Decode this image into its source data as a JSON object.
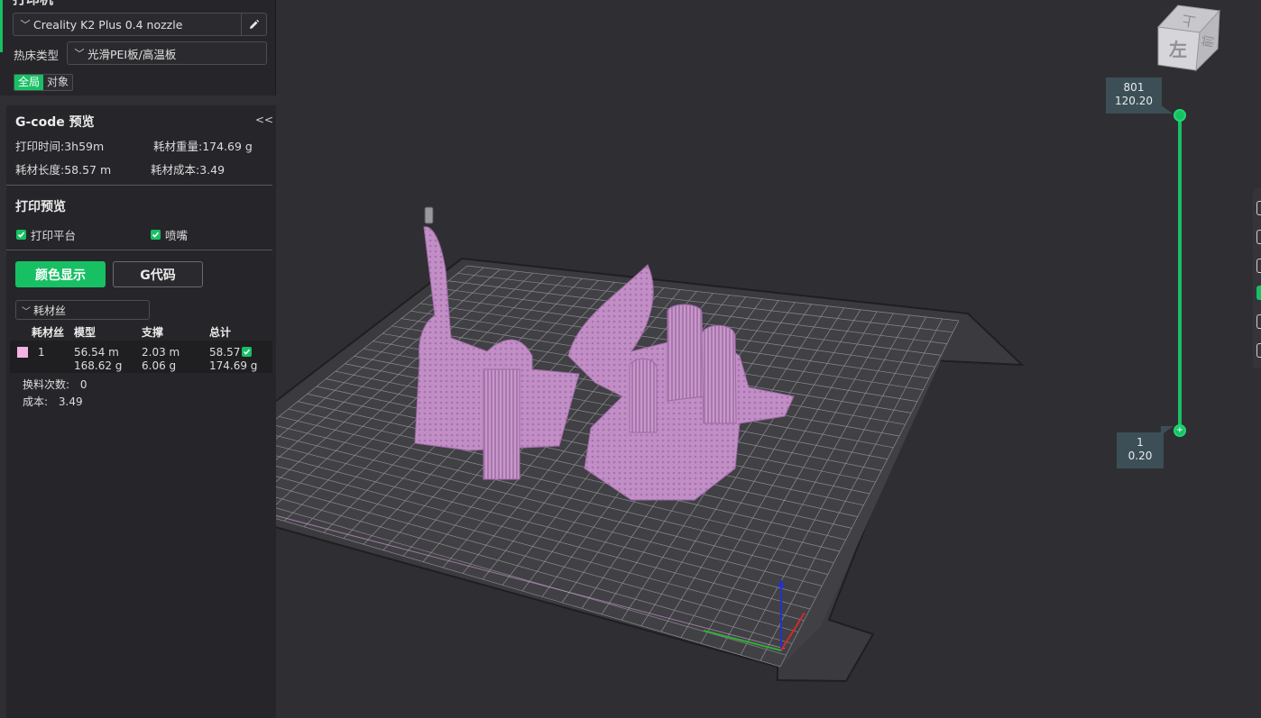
{
  "printer_section": {
    "title_clipped": "打印机",
    "printer_name": "Creality K2 Plus 0.4 nozzle",
    "bed_type_label": "热床类型",
    "bed_type_value": "光滑PEI板/高温板",
    "scope_global": "全局",
    "scope_object": "对象"
  },
  "gcode_preview": {
    "title": "G-code 预览",
    "collapse_icon": "<<",
    "print_time": "打印时间:3h59m",
    "filament_weight": "耗材重量:174.69 g",
    "filament_length": "耗材长度:58.57 m",
    "filament_cost": "耗材成本:3.49"
  },
  "print_preview": {
    "title": "打印预览",
    "show_bed_label": "打印平台",
    "show_nozzle_label": "喷嘴",
    "show_bed": true,
    "show_nozzle": true
  },
  "view_mode": {
    "color_display": "颜色显示",
    "gcode": "G代码",
    "color_scheme": "耗材丝"
  },
  "filament_table": {
    "headers": [
      "耗材丝",
      "模型",
      "支撑",
      "总计"
    ],
    "rows": [
      {
        "color": "#f3b3e3",
        "index": "1",
        "model_length": "56.54 m",
        "model_weight": "168.62 g",
        "support_length": "2.03 m",
        "support_weight": "6.06 g",
        "total_length": "58.57",
        "total_weight": "174.69 g"
      }
    ],
    "change_count_label": "换料次数:",
    "change_count": "0",
    "cost_label": "成本:",
    "cost": "3.49"
  },
  "view_cube": {
    "top_face": "上",
    "left_face": "左",
    "front_face": "前"
  },
  "layer_slider": {
    "top_layer": "801",
    "top_height": "120.20",
    "bottom_layer": "1",
    "bottom_height": "0.20",
    "slider_color": "#18c064"
  },
  "colors": {
    "accent": "#18c064",
    "model": "#c590c8",
    "background": "#2f2f33"
  }
}
